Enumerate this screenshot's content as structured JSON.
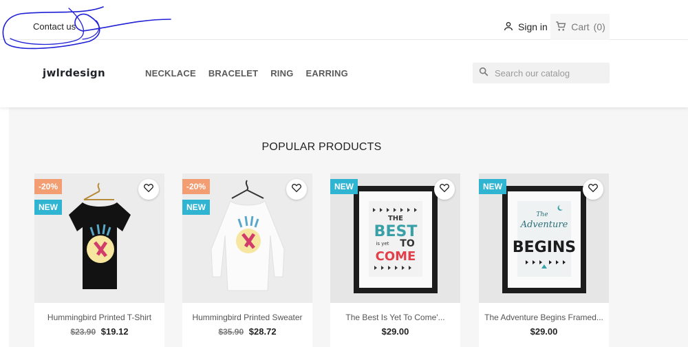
{
  "top_bar": {
    "contact_label": "Contact us",
    "signin_label": "Sign in",
    "cart_label": "Cart",
    "cart_count": "(0)"
  },
  "header": {
    "logo_text": "jwlrdesign",
    "nav": [
      "NECKLACE",
      "BRACELET",
      "RING",
      "EARRING"
    ],
    "search_placeholder": "Search our catalog"
  },
  "section": {
    "title": "POPULAR PRODUCTS"
  },
  "products": [
    {
      "name": "Hummingbird Printed T-Shirt",
      "discount": "-20%",
      "badge": "NEW",
      "old_price": "$23.90",
      "price": "$19.12"
    },
    {
      "name": "Hummingbird Printed Sweater",
      "discount": "-20%",
      "badge": "NEW",
      "old_price": "$35.90",
      "price": "$28.72"
    },
    {
      "name": "The Best Is Yet To Come'...",
      "discount": "",
      "badge": "NEW",
      "old_price": "",
      "price": "$29.00"
    },
    {
      "name": "The Adventure Begins Framed...",
      "discount": "",
      "badge": "NEW",
      "old_price": "",
      "price": "$29.00"
    }
  ],
  "poster_texts": {
    "best": [
      "THE",
      "BEST",
      "is yet",
      "TO",
      "COME"
    ],
    "adventure": [
      "The",
      "Adventure",
      "BEGINS"
    ]
  },
  "colors": {
    "accent": "#2fb5d2",
    "discount": "#f39d72",
    "scribble": "#1f1fd6"
  },
  "icons": {
    "signin": "person-icon",
    "cart": "shopping-cart-icon",
    "search": "search-icon",
    "wishlist": "heart-outline-icon"
  }
}
